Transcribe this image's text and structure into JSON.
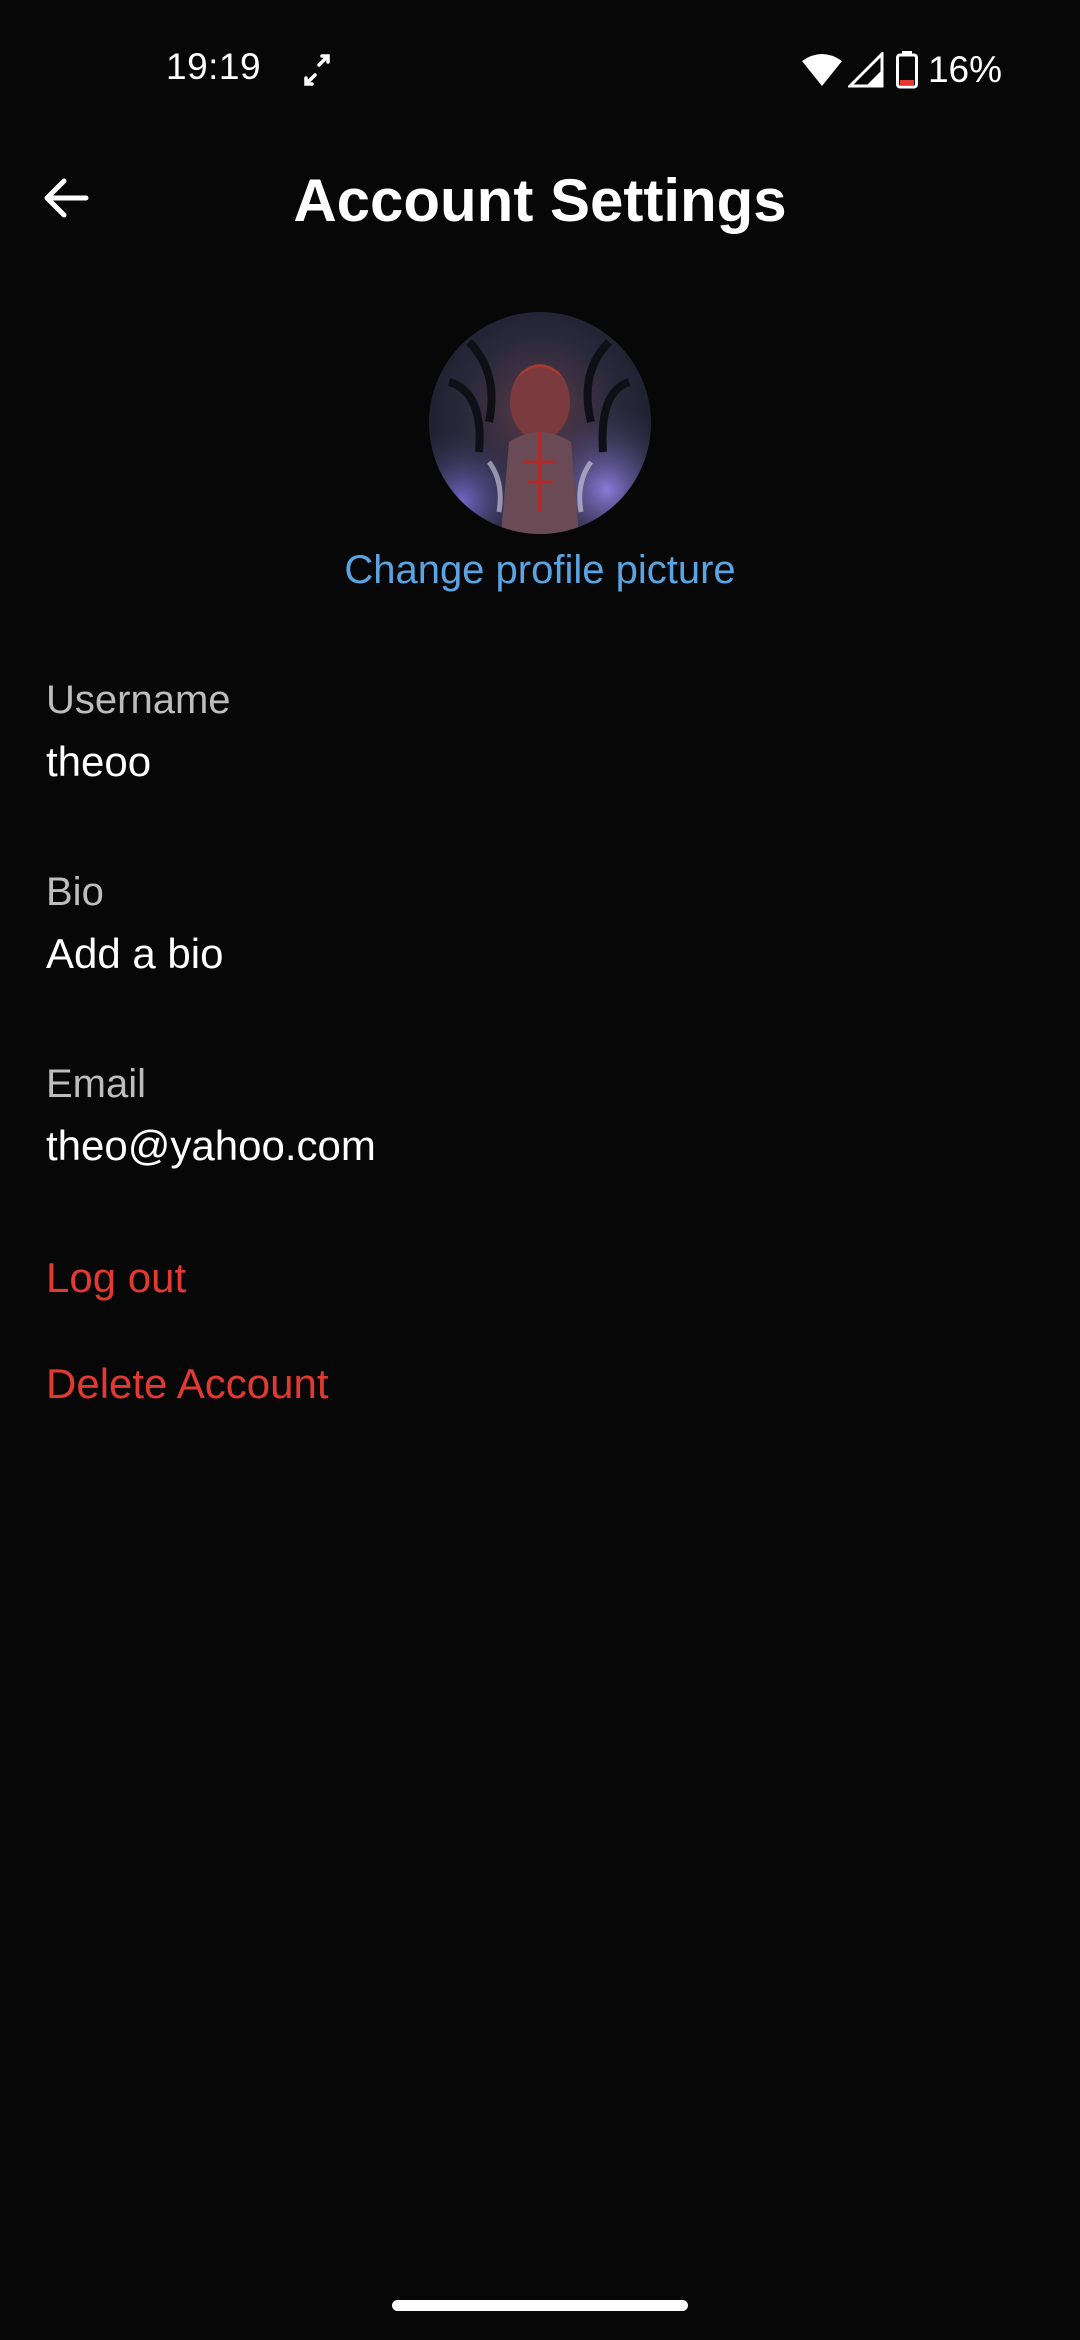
{
  "status_bar": {
    "time": "19:19",
    "battery_percent": "16%",
    "icons": [
      "sync-icon",
      "wifi-icon",
      "cell-signal-icon",
      "battery-icon"
    ]
  },
  "header": {
    "title": "Account Settings",
    "back_icon": "arrow-left-icon"
  },
  "profile": {
    "change_picture_label": "Change profile picture"
  },
  "fields": {
    "username": {
      "label": "Username",
      "value": "theoo"
    },
    "bio": {
      "label": "Bio",
      "value": "Add a bio"
    },
    "email": {
      "label": "Email",
      "value": "theo@yahoo.com"
    }
  },
  "actions": {
    "logout_label": "Log out",
    "delete_label": "Delete Account"
  },
  "colors": {
    "background": "#070707",
    "link_blue": "#5aa4e3",
    "danger_red": "#e23a30",
    "label_gray": "#bdbdbd"
  }
}
